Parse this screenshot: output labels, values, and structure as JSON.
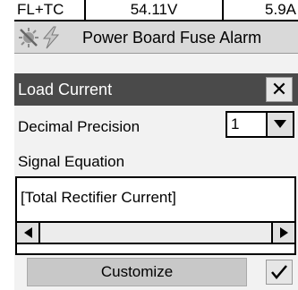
{
  "status_bar": {
    "mode": "FL+TC",
    "voltage": "54.11V",
    "current": "5.9A"
  },
  "alarm_bar": {
    "text": "Power Board Fuse Alarm",
    "icons": [
      "alarm-muted-icon",
      "lightning-icon"
    ]
  },
  "dialog": {
    "title": "Load Current",
    "close_icon": "close-icon"
  },
  "decimal_precision": {
    "label": "Decimal Precision",
    "value": "1"
  },
  "signal_equation": {
    "label": "Signal Equation",
    "value": "[Total Rectifier Current]"
  },
  "actions": {
    "customize_label": "Customize",
    "confirm_icon": "checkmark-icon"
  }
}
